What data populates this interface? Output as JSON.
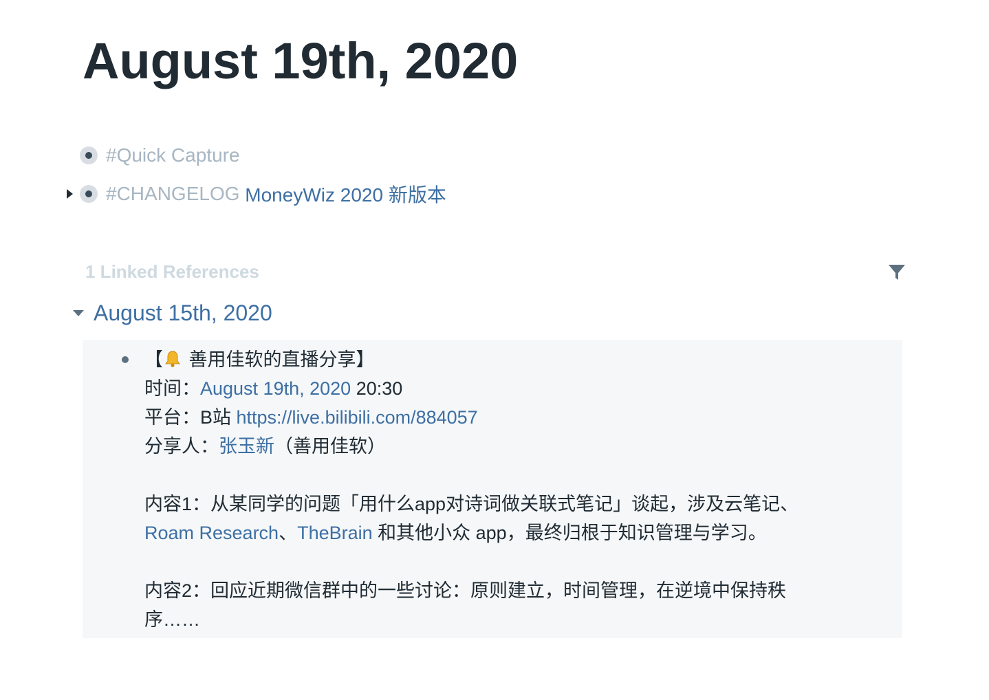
{
  "page": {
    "title": "August 19th, 2020"
  },
  "blocks": [
    {
      "tag": "#Quick Capture"
    },
    {
      "tag": "#CHANGELOG",
      "link": "MoneyWiz 2020 新版本"
    }
  ],
  "linked_references": {
    "header": "1 Linked References",
    "filter_icon": "filter-icon",
    "groups": [
      {
        "page_title": "August 15th, 2020",
        "block": {
          "title_prefix": "【",
          "bell_icon": "bell-icon",
          "title_text": " 善用佳软的直播分享】",
          "time_label": "时间：",
          "time_link": "August 19th, 2020",
          "time_suffix": " 20:30",
          "platform_label": "平台：B站 ",
          "platform_url": "https://live.bilibili.com/884057",
          "speaker_label": "分享人：",
          "speaker_link": "张玉新",
          "speaker_suffix": "（善用佳软）",
          "content1_line1": "内容1：从某同学的问题「用什么app对诗词做关联式笔记」谈起，涉及云笔记、",
          "content1_link1": "Roam Research",
          "content1_sep": "、",
          "content1_link2": "TheBrain",
          "content1_line2_rest": " 和其他小众 app，最终归根于知识管理与学习。",
          "content2_line1": "内容2：回应近期微信群中的一些讨论：原则建立，时间管理，在逆境中保持秩",
          "content2_line2": "序……"
        }
      }
    ]
  },
  "colors": {
    "text": "#202b33",
    "link": "#3d6fa3",
    "tag": "#a7b6c2",
    "muted_header": "#ced9e0",
    "ref_background": "#f5f7f9"
  }
}
